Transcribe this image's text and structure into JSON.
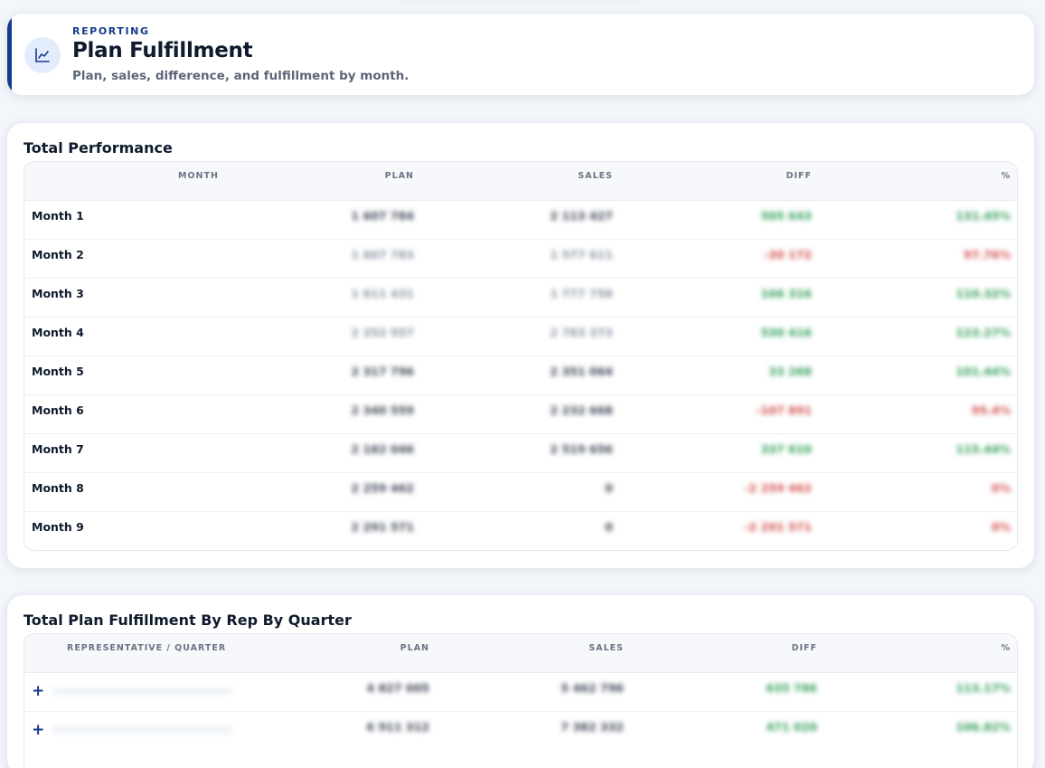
{
  "header": {
    "eyebrow": "REPORTING",
    "title": "Plan Fulfillment",
    "subtitle": "Plan, sales, difference, and fulfillment by month.",
    "icon": "line-chart-icon",
    "accent_color": "#153b8e"
  },
  "total_performance": {
    "title": "Total Performance",
    "columns": {
      "month": "MONTH",
      "plan": "PLAN",
      "sales": "SALES",
      "diff": "DIFF",
      "pct": "%"
    },
    "rows": [
      {
        "month": "Month 1",
        "plan": "1 607 784",
        "sales": "2 113 427",
        "diff": "505 643",
        "pct": "131.45%",
        "sign": "pos"
      },
      {
        "month": "Month 2",
        "plan": "1 607 783",
        "sales": "1 577 611",
        "diff": "-30 172",
        "pct": "97.76%",
        "sign": "neg"
      },
      {
        "month": "Month 3",
        "plan": "1 611 431",
        "sales": "1 777 758",
        "diff": "166 316",
        "pct": "110.32%",
        "sign": "pos"
      },
      {
        "month": "Month 4",
        "plan": "2 252 957",
        "sales": "2 783 373",
        "diff": "530 416",
        "pct": "123.27%",
        "sign": "pos"
      },
      {
        "month": "Month 5",
        "plan": "2 317 796",
        "sales": "2 351 064",
        "diff": "33 268",
        "pct": "101.44%",
        "sign": "pos"
      },
      {
        "month": "Month 6",
        "plan": "2 340 559",
        "sales": "2 232 668",
        "diff": "-107 891",
        "pct": "95.4%",
        "sign": "neg"
      },
      {
        "month": "Month 7",
        "plan": "2 182 046",
        "sales": "2 519 656",
        "diff": "337 610",
        "pct": "115.44%",
        "sign": "pos"
      },
      {
        "month": "Month 8",
        "plan": "2 259 462",
        "sales": "0",
        "diff": "-2 259 462",
        "pct": "0%",
        "sign": "neg"
      },
      {
        "month": "Month 9",
        "plan": "2 291 571",
        "sales": "0",
        "diff": "-2 291 571",
        "pct": "0%",
        "sign": "neg"
      }
    ]
  },
  "rep_quarter": {
    "title": "Total Plan Fulfillment By Rep By Quarter",
    "columns": {
      "rep": "REPRESENTATIVE / QUARTER",
      "plan": "PLAN",
      "sales": "SALES",
      "diff": "DIFF",
      "pct": "%"
    },
    "rows": [
      {
        "expand": "+",
        "plan": "4 827 005",
        "sales": "5 462 796",
        "diff": "635 786",
        "pct": "113.17%"
      },
      {
        "expand": "+",
        "plan": "6 911 312",
        "sales": "7 382 332",
        "diff": "471 020",
        "pct": "106.82%"
      }
    ]
  }
}
